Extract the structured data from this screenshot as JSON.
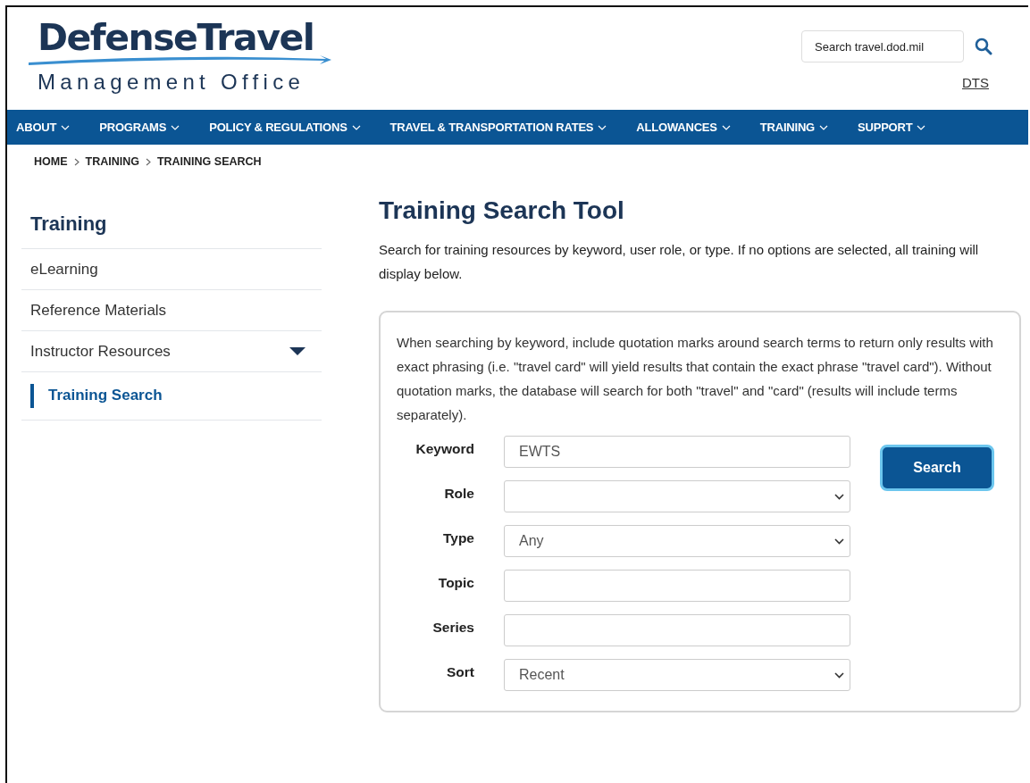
{
  "header": {
    "logo_title": "DefenseTravel",
    "logo_subtitle": "Management Office",
    "search": {
      "placeholder": "Search travel.dod.mil"
    },
    "link": "DTS"
  },
  "nav": [
    {
      "label": "ABOUT"
    },
    {
      "label": "PROGRAMS"
    },
    {
      "label": "POLICY & REGULATIONS"
    },
    {
      "label": "TRAVEL & TRANSPORTATION RATES"
    },
    {
      "label": "ALLOWANCES"
    },
    {
      "label": "TRAINING"
    },
    {
      "label": "SUPPORT"
    }
  ],
  "breadcrumb": [
    "HOME",
    "TRAINING",
    "TRAINING SEARCH"
  ],
  "sidebar": {
    "title": "Training",
    "items": [
      {
        "label": "eLearning",
        "selected": false,
        "expandable": false
      },
      {
        "label": "Reference Materials",
        "selected": false,
        "expandable": false
      },
      {
        "label": "Instructor Resources",
        "selected": false,
        "expandable": true
      },
      {
        "label": "Training Search",
        "selected": true,
        "expandable": false
      }
    ]
  },
  "main": {
    "title": "Training Search Tool",
    "intro": "Search for training resources by keyword, user role, or type. If no options are selected, all training will display below.",
    "note": "When searching by keyword, include quotation marks around search terms to return only results with exact phrasing (i.e. \"travel card\" will yield results that contain the exact phrase \"travel card\"). Without quotation marks, the database will search for both \"travel\" and \"card\" (results will include terms separately).",
    "fields": [
      {
        "label": "Keyword",
        "kind": "text",
        "value": "EWTS"
      },
      {
        "label": "Role",
        "kind": "select"
      },
      {
        "label": "Type",
        "kind": "select",
        "value": "Any"
      },
      {
        "label": "Topic",
        "kind": "text"
      },
      {
        "label": "Series",
        "kind": "text"
      },
      {
        "label": "Sort",
        "kind": "select",
        "value": "Recent"
      }
    ],
    "search_button": "Search"
  }
}
